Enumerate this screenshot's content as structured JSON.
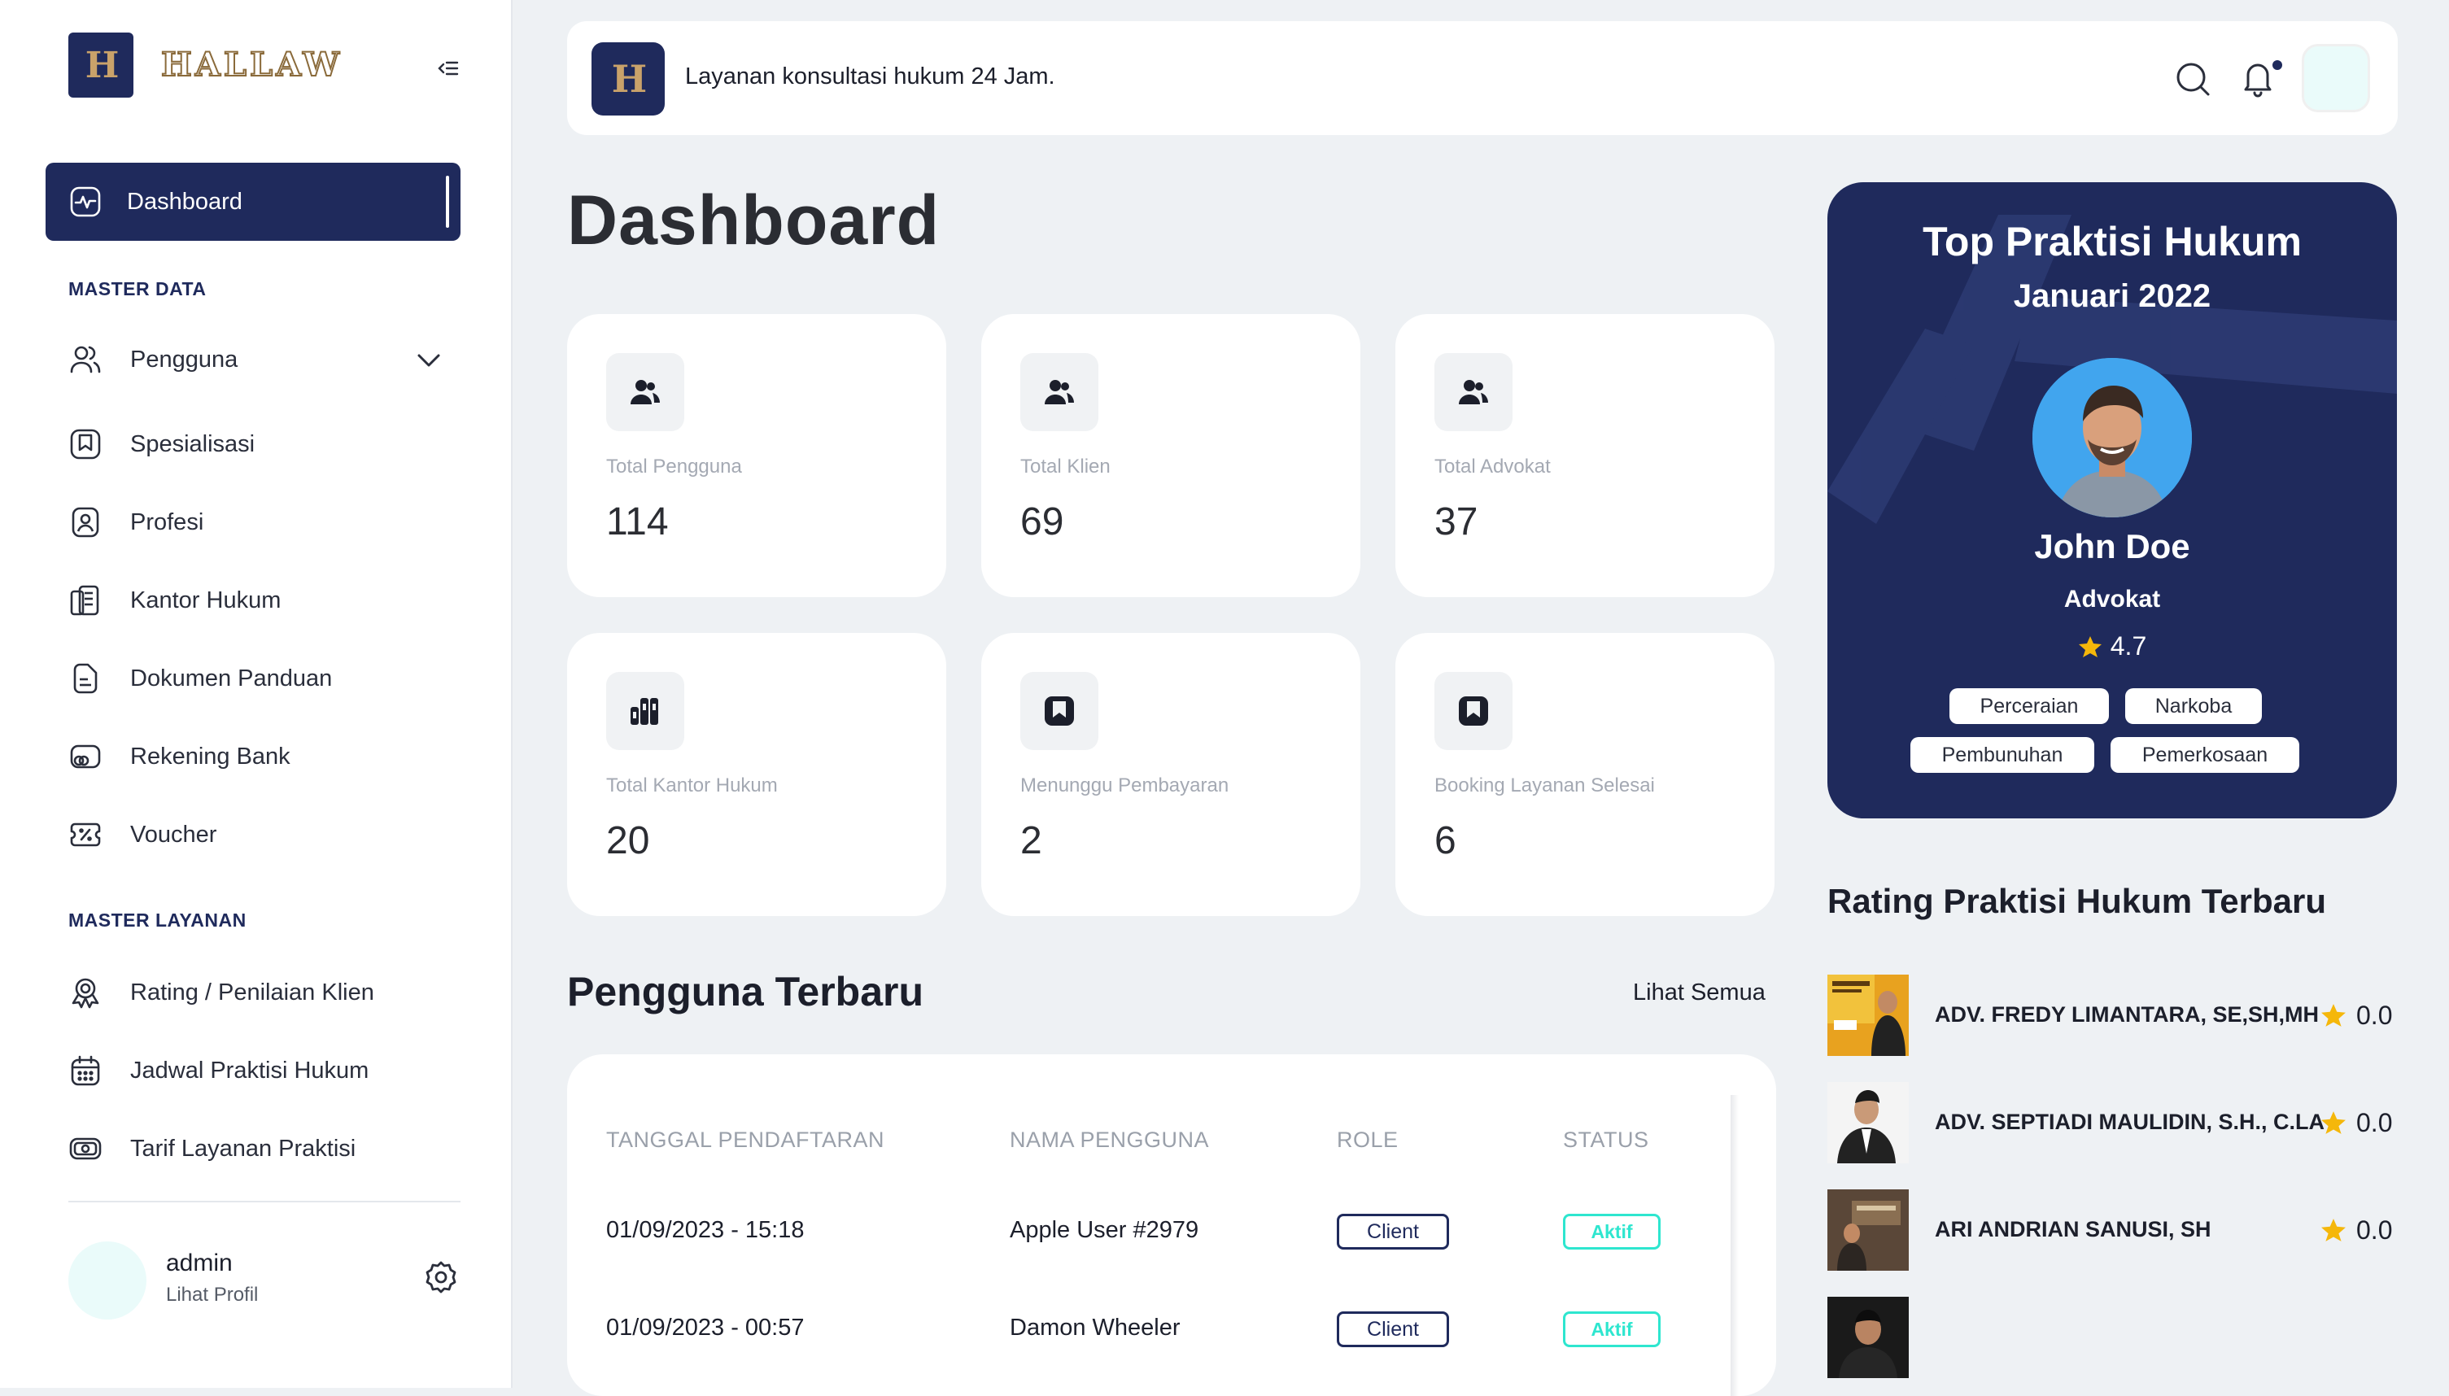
{
  "brand": {
    "logo_letter": "H",
    "logo_text": "HALLAW"
  },
  "sidebar": {
    "active_item": {
      "label": "Dashboard",
      "icon": "activity-icon"
    },
    "section_master_data": "MASTER DATA",
    "master_data_items": [
      {
        "label": "Pengguna",
        "icon": "users-icon"
      },
      {
        "label": "Spesialisasi",
        "icon": "bookmark-icon"
      },
      {
        "label": "Profesi",
        "icon": "profile-card-icon"
      },
      {
        "label": "Kantor Hukum",
        "icon": "building-icon"
      },
      {
        "label": "Dokumen Panduan",
        "icon": "document-icon"
      },
      {
        "label": "Rekening Bank",
        "icon": "bank-card-icon"
      },
      {
        "label": "Voucher",
        "icon": "voucher-icon"
      }
    ],
    "section_master_layanan": "MASTER LAYANAN",
    "master_layanan_items": [
      {
        "label": "Rating / Penilaian Klien",
        "icon": "award-icon"
      },
      {
        "label": "Jadwal Praktisi Hukum",
        "icon": "calendar-icon"
      },
      {
        "label": "Tarif Layanan Praktisi",
        "icon": "money-icon"
      }
    ],
    "admin": {
      "name": "admin",
      "link": "Lihat Profil"
    }
  },
  "topbar": {
    "tagline": "Layanan konsultasi hukum 24 Jam."
  },
  "main": {
    "title": "Dashboard",
    "stats": [
      {
        "label": "Total Pengguna",
        "value": "114"
      },
      {
        "label": "Total Klien",
        "value": "69"
      },
      {
        "label": "Total Advokat",
        "value": "37"
      },
      {
        "label": "Total Kantor Hukum",
        "value": "20"
      },
      {
        "label": "Menunggu Pembayaran",
        "value": "2"
      },
      {
        "label": "Booking Layanan Selesai",
        "value": "6"
      }
    ],
    "recent_users": {
      "title": "Pengguna Terbaru",
      "see_all": "Lihat Semua",
      "columns": [
        "TANGGAL PENDAFTARAN",
        "NAMA PENGGUNA",
        "ROLE",
        "STATUS"
      ],
      "rows": [
        {
          "date": "01/09/2023 - 15:18",
          "name": "Apple User #2979",
          "role": "Client",
          "status": "Aktif"
        },
        {
          "date": "01/09/2023 - 00:57",
          "name": "Damon Wheeler",
          "role": "Client",
          "status": "Aktif"
        }
      ]
    }
  },
  "top_praktisi": {
    "title": "Top Praktisi Hukum",
    "period": "Januari 2022",
    "name": "John Doe",
    "role": "Advokat",
    "rating": "4.7",
    "tags": [
      "Perceraian",
      "Narkoba",
      "Pembunuhan",
      "Pemerkosaan"
    ]
  },
  "rating_list": {
    "title": "Rating Praktisi Hukum Terbaru",
    "items": [
      {
        "name": "ADV. FREDY LIMANTARA, SE,SH,MH",
        "score": "0.0"
      },
      {
        "name": "ADV. SEPTIADI MAULIDIN, S.H., C.LA",
        "score": "0.0"
      },
      {
        "name": "ARI ANDRIAN SANUSI, SH",
        "score": "0.0"
      }
    ]
  },
  "colors": {
    "navy": "#1f2a5c",
    "teal": "#2ee6cf",
    "star": "#f5b70a",
    "bg": "#eef1f4"
  }
}
